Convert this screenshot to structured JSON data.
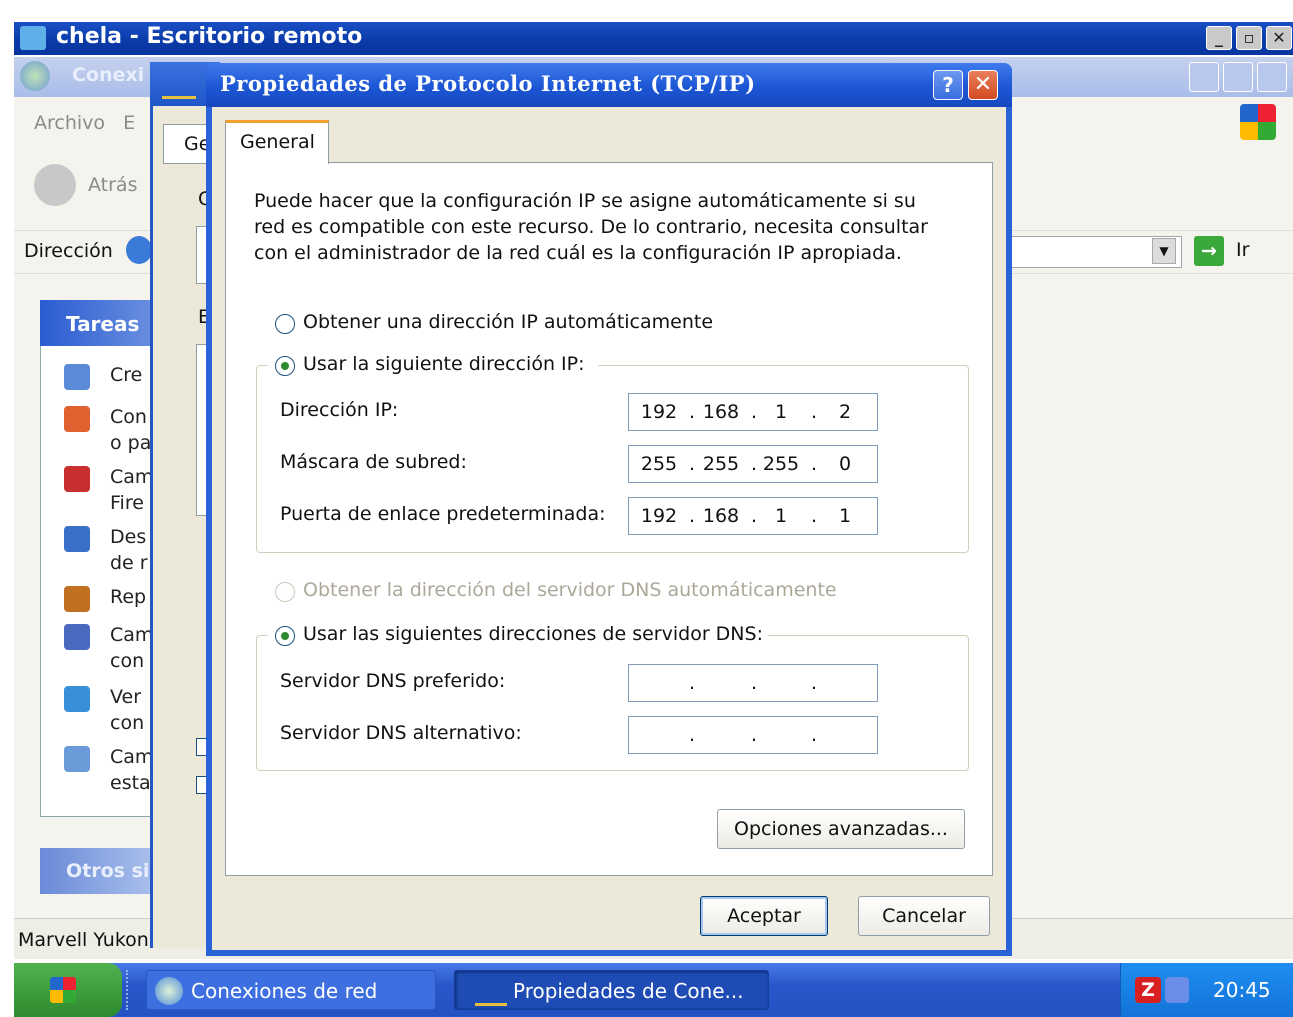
{
  "remote_window": {
    "title": "chela - Escritorio remoto",
    "buttons": [
      "_",
      "▫",
      "✕"
    ]
  },
  "explorer": {
    "title_partial": "Conexi",
    "menu_partial": "Archivo   E",
    "back_label": "Atrás",
    "address_label": "Dirección",
    "go_label": "Ir",
    "tasks_header": "Tareas",
    "tasks": [
      {
        "line1": "Cre",
        "line2": ""
      },
      {
        "line1": "Con",
        "line2": "o pa"
      },
      {
        "line1": "Cam",
        "line2": "Fire"
      },
      {
        "line1": "Des",
        "line2": "de r"
      },
      {
        "line1": "Rep",
        "line2": ""
      },
      {
        "line1": "Cam",
        "line2": "con"
      },
      {
        "line1": "Ver",
        "line2": "con"
      },
      {
        "line1": "Cam",
        "line2": "esta"
      }
    ],
    "otros_header": "Otros si",
    "status_text": "Marvell Yukon"
  },
  "middle_window": {
    "tab_partial": "Ge",
    "letters": [
      "C",
      "E"
    ]
  },
  "dialog": {
    "title": "Propiedades de Protocolo Internet (TCP/IP)",
    "help_label": "?",
    "close_label": "✕",
    "tab": "General",
    "description": [
      "Puede hacer que la configuración IP se asigne automáticamente si su",
      "red es compatible con este recurso. De lo contrario, necesita consultar",
      "con el administrador de la red cuál es la configuración IP apropiada."
    ],
    "ip_auto_label": "Obtener una dirección IP automáticamente",
    "ip_manual_label": "Usar la siguiente dirección IP:",
    "ip_mode": "manual",
    "fields": [
      {
        "label": "Dirección IP:",
        "octets": [
          "192",
          "168",
          "1",
          "2"
        ]
      },
      {
        "label": "Máscara de subred:",
        "octets": [
          "255",
          "255",
          "255",
          "0"
        ]
      },
      {
        "label": "Puerta de enlace predeterminada:",
        "octets": [
          "192",
          "168",
          "1",
          "1"
        ]
      }
    ],
    "dns_auto_label": "Obtener la dirección del servidor DNS automáticamente",
    "dns_manual_label": "Usar las siguientes direcciones de servidor DNS:",
    "dns_mode": "manual",
    "dns_fields": [
      {
        "label": "Servidor DNS preferido:",
        "octets": [
          "",
          "",
          "",
          ""
        ]
      },
      {
        "label": "Servidor DNS alternativo:",
        "octets": [
          "",
          "",
          "",
          ""
        ]
      }
    ],
    "advanced_label": "Opciones avanzadas...",
    "ok_label": "Aceptar",
    "cancel_label": "Cancelar"
  },
  "taskbar": {
    "items": [
      {
        "label": "Conexiones de red",
        "active": false
      },
      {
        "label": "Propiedades de Cone...",
        "active": true
      }
    ],
    "clock": "20:45"
  },
  "colors": {
    "xp_blue": "#1f56c8",
    "dialog_bg": "#ece9d8",
    "tab_accent": "#f0a030",
    "radio_dot": "#2e8a2e"
  }
}
